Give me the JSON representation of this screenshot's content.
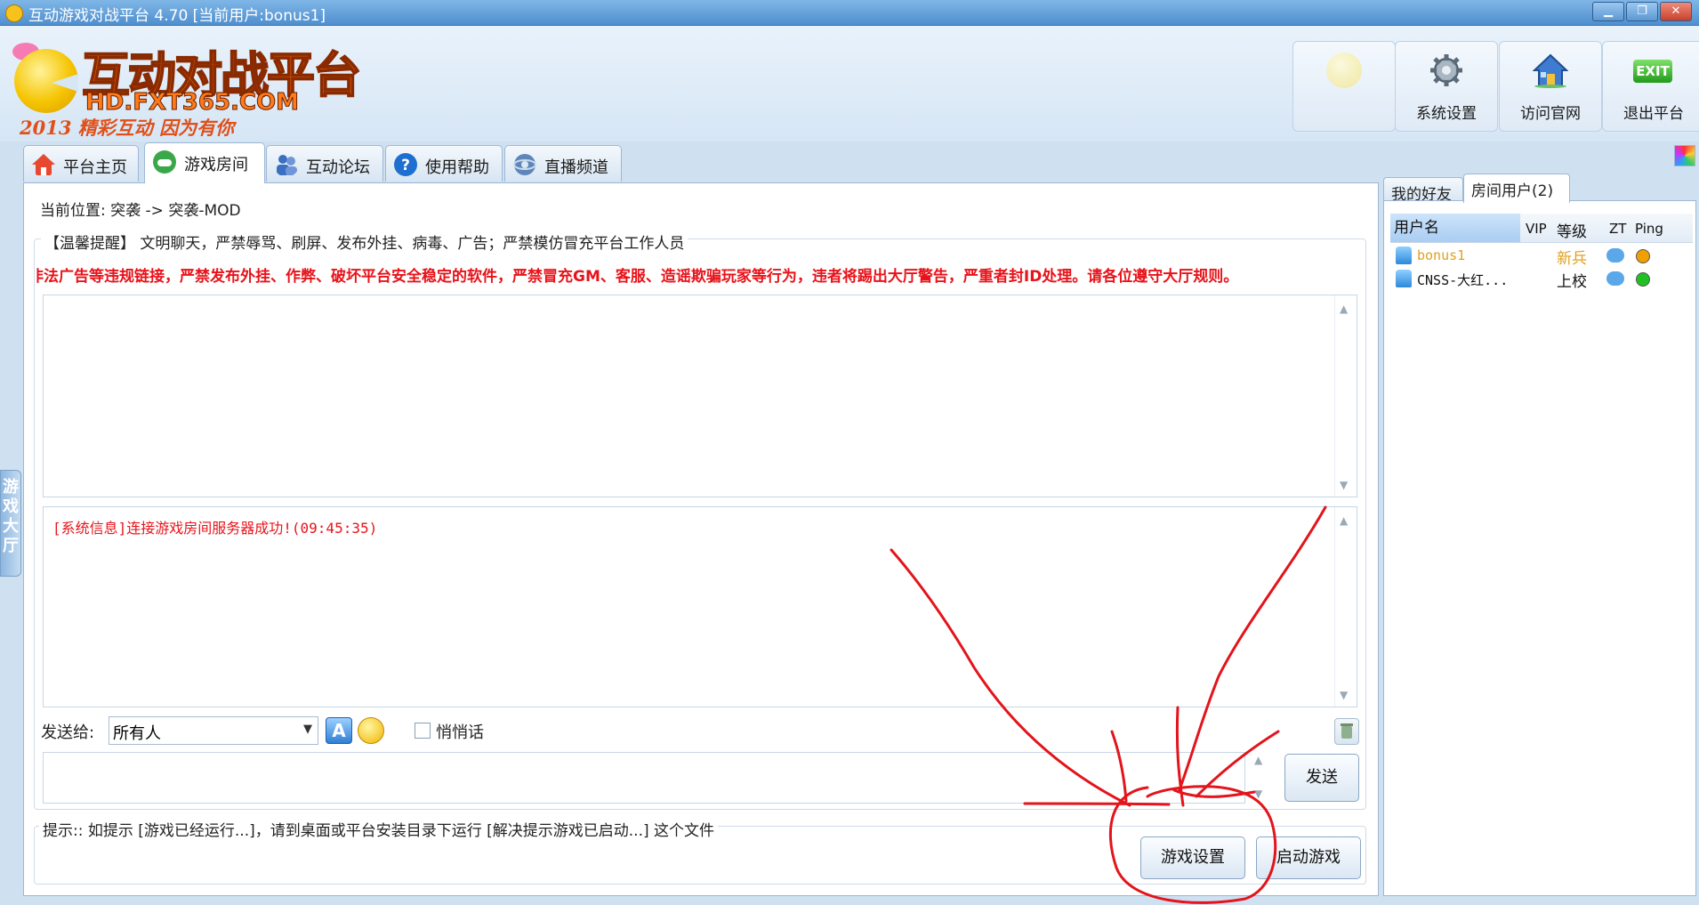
{
  "window": {
    "title": "互动游戏对战平台 4.70 [当前用户:bonus1]",
    "controls": [
      "▁",
      "❐",
      "✕"
    ]
  },
  "logo": {
    "main": "互动对战平台",
    "url": "HD.FXT365.COM",
    "slogan": "2013 精彩互动 因为有你"
  },
  "toolbar": {
    "buttons": [
      {
        "label": "系统设置",
        "icon": "gear-icon"
      },
      {
        "label": "访问官网",
        "icon": "home-icon"
      },
      {
        "label": "退出平台",
        "icon": "exit-icon",
        "badge": "EXIT"
      }
    ]
  },
  "tabs": [
    {
      "label": "平台主页",
      "icon": "house-icon",
      "color": "#e8482e"
    },
    {
      "label": "游戏房间",
      "icon": "gamepad-icon",
      "color": "#3aa84a",
      "active": true
    },
    {
      "label": "互动论坛",
      "icon": "users-icon",
      "color": "#3b6fc0"
    },
    {
      "label": "使用帮助",
      "icon": "help-icon",
      "color": "#1e6fd0"
    },
    {
      "label": "直播频道",
      "icon": "broadcast-icon",
      "color": "#5f86b8"
    }
  ],
  "side_tab": {
    "label": "游戏大厅"
  },
  "location": "当前位置: 突袭 -> 突袭-MOD",
  "notice": {
    "title": "【温馨提醒】 文明聊天，严禁辱骂、刷屏、发布外挂、病毒、广告；严禁模仿冒充平台工作人员",
    "rules": "非法广告等违规链接，严禁发布外挂、作弊、破坏平台安全稳定的软件，严禁冒充GM、客服、造谣欺骗玩家等行为，违者将踢出大厅警告，严重者封ID处理。请各位遵守大厅规则。"
  },
  "chat": {
    "system_message": "[系统信息]连接游戏房间服务器成功!(09:45:35)"
  },
  "send": {
    "to_label": "发送给:",
    "recipient": "所有人",
    "whisper_label": "悄悄话",
    "send_button": "发送"
  },
  "tip": "提示:: 如提示 [游戏已经运行...]，请到桌面或平台安装目录下运行 [解决提示游戏已启动...] 这个文件",
  "actions": {
    "game_settings": "游戏设置",
    "start_game": "启动游戏"
  },
  "right_panel": {
    "tabs": [
      "我的好友",
      "房间用户(2)"
    ],
    "columns": [
      "用户名",
      "VIP",
      "等级",
      "ZT",
      "Ping"
    ],
    "users": [
      {
        "name": "bonus1",
        "level": "新兵",
        "name_color": "#e0a020",
        "level_color": "#e0a020",
        "ping_color": "#f0a000"
      },
      {
        "name": "CNSS-大红...",
        "level": "上校",
        "name_color": "#111111",
        "level_color": "#111111",
        "ping_color": "#22c022"
      }
    ]
  },
  "colors": {
    "accent_red": "#e8131a",
    "annotation": "#e3141b"
  }
}
